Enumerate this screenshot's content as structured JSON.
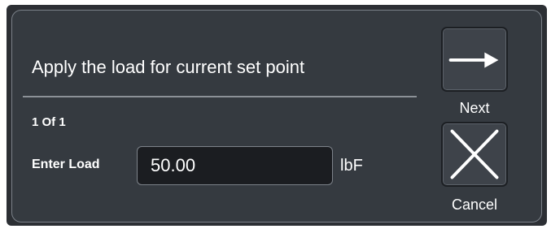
{
  "dialog": {
    "title": "Apply the load for current set point",
    "step": "1 Of 1",
    "load_label": "Enter Load",
    "load_value": "50.00",
    "load_unit": "lbF"
  },
  "buttons": {
    "next_label": "Next",
    "next_icon": "arrow-right-icon",
    "cancel_label": "Cancel",
    "cancel_icon": "x-icon"
  },
  "colors": {
    "background": "#2c2f34",
    "panel": "#353a40",
    "input_bg": "#1b1d21",
    "text": "#ffffff",
    "button_bg": "#3e434a"
  }
}
